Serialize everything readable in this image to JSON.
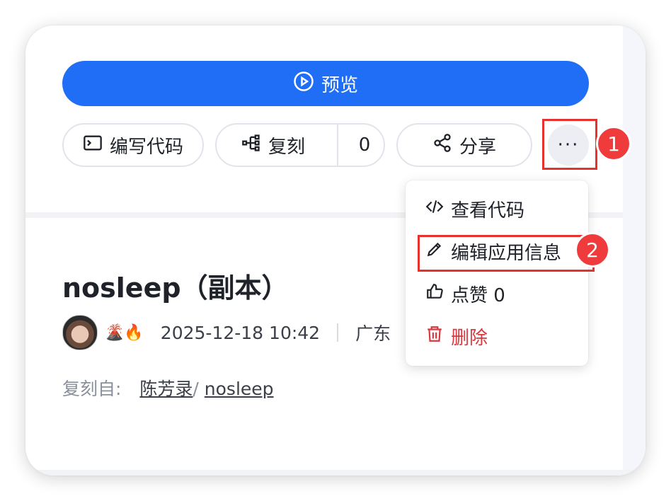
{
  "actions": {
    "preview_label": "预览",
    "code_label": "编写代码",
    "fork_label": "复刻",
    "fork_count": "0",
    "share_label": "分享",
    "more_label": "···"
  },
  "menu": {
    "items": [
      {
        "label": "查看代码",
        "icon": "code-icon"
      },
      {
        "label": "编辑应用信息",
        "icon": "pencil-icon"
      },
      {
        "label": "点赞 0",
        "icon": "thumbs-up-icon"
      },
      {
        "label": "删除",
        "icon": "trash-icon",
        "color": "#d9363e"
      }
    ]
  },
  "app": {
    "title": "nosleep（副本）",
    "emoji": "🌋🔥",
    "date": "2025-12-18 10:42",
    "location": "广东"
  },
  "source": {
    "label": "复刻自:",
    "author": "陈芳录",
    "separator": "/",
    "name": "nosleep"
  },
  "annotations": {
    "step1": "1",
    "step2": "2"
  },
  "colors": {
    "primary": "#1f6ef5",
    "danger": "#d9363e",
    "annotation": "#ef3b3b"
  }
}
